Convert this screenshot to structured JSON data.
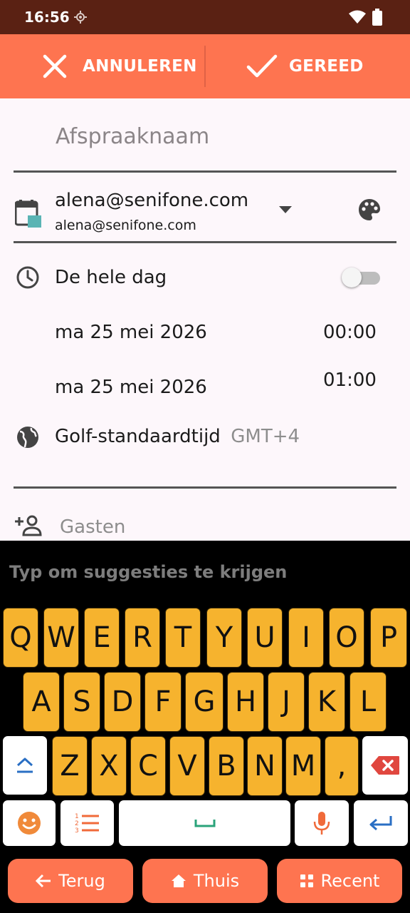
{
  "status_bar": {
    "time": "16:56"
  },
  "action_bar": {
    "cancel_label": "ANNULEREN",
    "done_label": "GEREED"
  },
  "form": {
    "title_placeholder": "Afspraaknaam",
    "title_value": "",
    "account_name": "alena@senifone.com",
    "account_email": "alena@senifone.com",
    "all_day_label": "De hele dag",
    "all_day_enabled": false,
    "start_date": "ma 25 mei 2026",
    "start_time": "00:00",
    "end_date": "ma 25 mei 2026",
    "end_time": "01:00",
    "timezone_name": "Golf-standaardtijd",
    "timezone_offset": "GMT+4",
    "guests_placeholder": "Gasten"
  },
  "keyboard": {
    "suggestion_hint": "Typ om suggesties te krijgen",
    "row1": [
      "Q",
      "W",
      "E",
      "R",
      "T",
      "Y",
      "U",
      "I",
      "O",
      "P"
    ],
    "row2": [
      "A",
      "S",
      "D",
      "F",
      "G",
      "H",
      "J",
      "K",
      "L"
    ],
    "row3": [
      "Z",
      "X",
      "C",
      "V",
      "B",
      "N",
      "M",
      ","
    ]
  },
  "nav": {
    "back_label": "Terug",
    "home_label": "Thuis",
    "recent_label": "Recent"
  },
  "colors": {
    "accent": "#fe7450",
    "status_bar": "#5a2113",
    "key": "#f6b32e",
    "calendar": "#5ab4b4"
  }
}
